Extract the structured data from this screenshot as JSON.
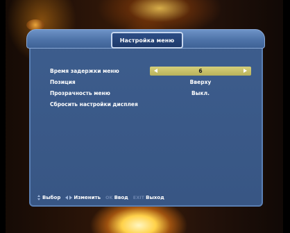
{
  "menu": {
    "title": "Настройка меню",
    "items": [
      {
        "label": "Время задержки меню",
        "value": "6",
        "selected": true
      },
      {
        "label": "Позиция",
        "value": "Вверху",
        "selected": false
      },
      {
        "label": "Прозрачность меню",
        "value": "Выкл.",
        "selected": false
      },
      {
        "label": "Сбросить настройки дисплея",
        "value": "",
        "selected": false
      }
    ]
  },
  "footer": {
    "select_label": "Выбор",
    "change_label": "Изменить",
    "ok_key": "OK",
    "enter_label": "Ввод",
    "exit_key": "EXIT",
    "exit_label": "Выход"
  },
  "colors": {
    "panel": "#3a5988",
    "highlight": "#c9c26a",
    "text": "#ffffff"
  }
}
